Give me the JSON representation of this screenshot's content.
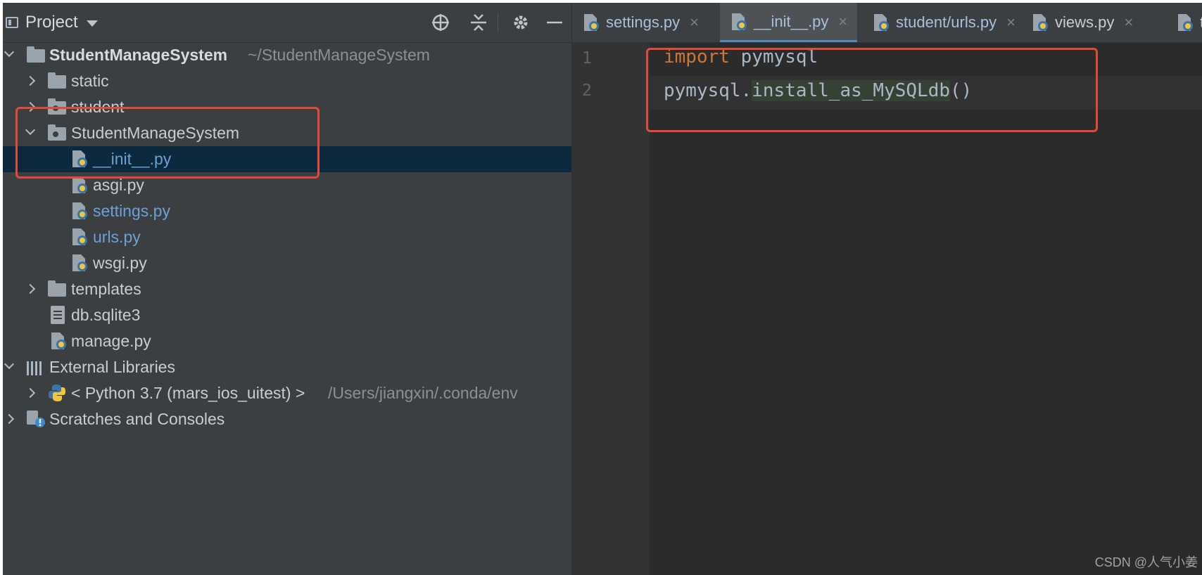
{
  "project_panel": {
    "title": "Project",
    "tree": [
      {
        "label": "StudentManageSystem",
        "path": "~/StudentManageSystem"
      },
      {
        "label": "static"
      },
      {
        "label": "student"
      },
      {
        "label": "StudentManageSystem"
      },
      {
        "label": "__init__.py",
        "selected": true
      },
      {
        "label": "asgi.py"
      },
      {
        "label": "settings.py"
      },
      {
        "label": "urls.py"
      },
      {
        "label": "wsgi.py"
      },
      {
        "label": "templates"
      },
      {
        "label": "db.sqlite3"
      },
      {
        "label": "manage.py"
      },
      {
        "label": "External Libraries"
      },
      {
        "label": "< Python 3.7 (mars_ios_uitest) >",
        "path": "/Users/jiangxin/.conda/env"
      },
      {
        "label": "Scratches and Consoles"
      }
    ]
  },
  "editor": {
    "tabs": [
      {
        "label": "settings.py"
      },
      {
        "label": "__init__.py",
        "active": true
      },
      {
        "label": "student/urls.py"
      },
      {
        "label": "views.py"
      },
      {
        "label": "te"
      }
    ],
    "close_glyph": "×",
    "lines": [
      {
        "num": "1",
        "keyword": "import",
        "rest": " pymysql"
      },
      {
        "num": "2",
        "prefix": "pymysql.",
        "call": "install_as_MySQLdb",
        "suffix": "()"
      }
    ]
  },
  "watermark": "CSDN @人气小姜",
  "colors": {
    "highlight_box": "#e04a3b",
    "keyword": "#cc7832",
    "selection": "#0d293e"
  }
}
